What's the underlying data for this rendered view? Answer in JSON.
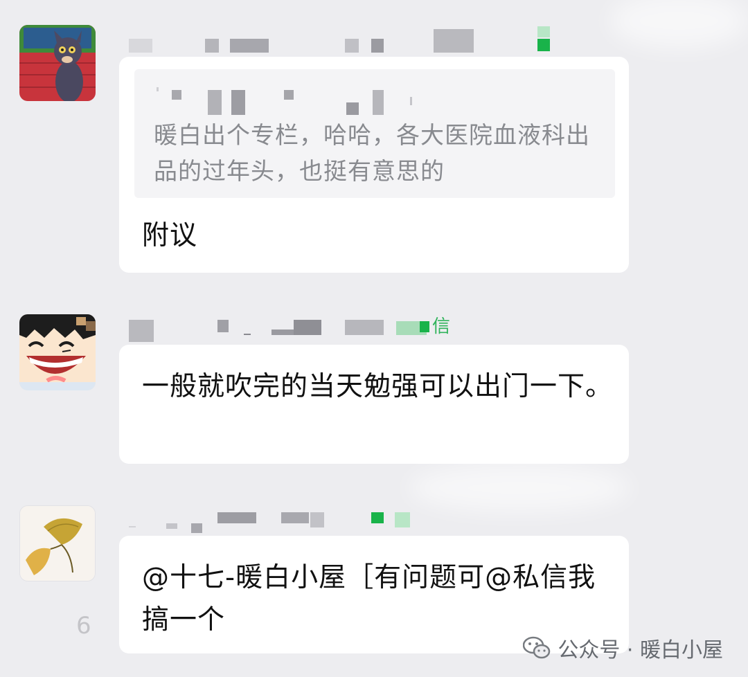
{
  "messages": [
    {
      "quote": "暖白出个专栏，哈哈，各大医院血液科出品的过年头，也挺有意思的",
      "text": "附议"
    },
    {
      "sender_visible": "信",
      "text": "一般就吹完的当天勉强可以出门一下。"
    },
    {
      "text": "@十七-暖白小屋［有问题可@私信我 搞一个"
    }
  ],
  "watermark": {
    "label": "公众号 · 暖白小屋",
    "icon": "wechat-icon"
  },
  "stray_digit": "6",
  "colors": {
    "background": "#ededf0",
    "bubble": "#ffffff",
    "quote_bg": "#f4f4f6",
    "quote_text": "#888a8f",
    "wechat_green": "#07c160"
  }
}
